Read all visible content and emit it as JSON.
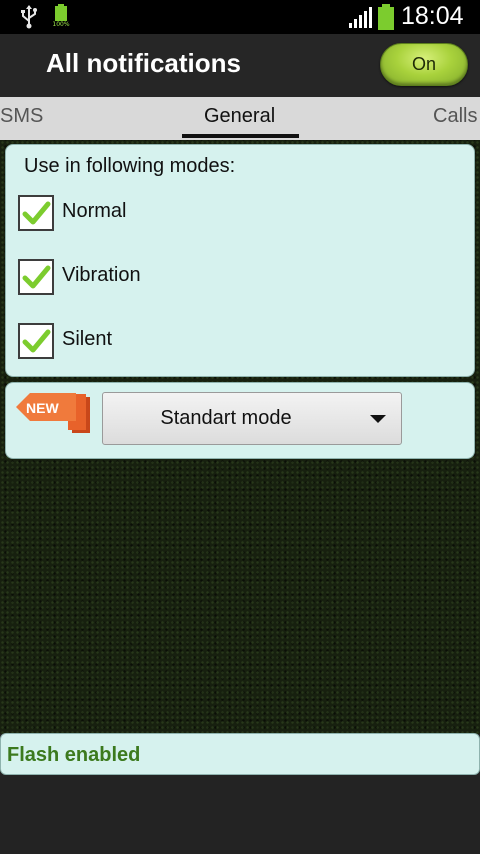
{
  "status_bar": {
    "time": "18:04",
    "battery_small_label": "100%",
    "icons": [
      "usb-icon",
      "battery-charging-icon",
      "signal-icon",
      "battery-icon"
    ]
  },
  "header": {
    "title": "All notifications",
    "toggle_label": "On"
  },
  "tabs": [
    {
      "label": "SMS",
      "selected": false
    },
    {
      "label": "General",
      "selected": true
    },
    {
      "label": "Calls",
      "selected": false
    }
  ],
  "modes": {
    "title": "Use in following modes:",
    "items": [
      {
        "label": "Normal",
        "checked": true
      },
      {
        "label": "Vibration",
        "checked": true
      },
      {
        "label": "Silent",
        "checked": true
      }
    ]
  },
  "mode_selector": {
    "badge": "NEW",
    "selected": "Standart mode"
  },
  "footer": {
    "status": "Flash enabled"
  },
  "colors": {
    "accent_green": "#a9d23c",
    "panel_bg": "#d6f2ee",
    "flash_text": "#3c7a1e",
    "badge_orange": "#e8622a"
  }
}
